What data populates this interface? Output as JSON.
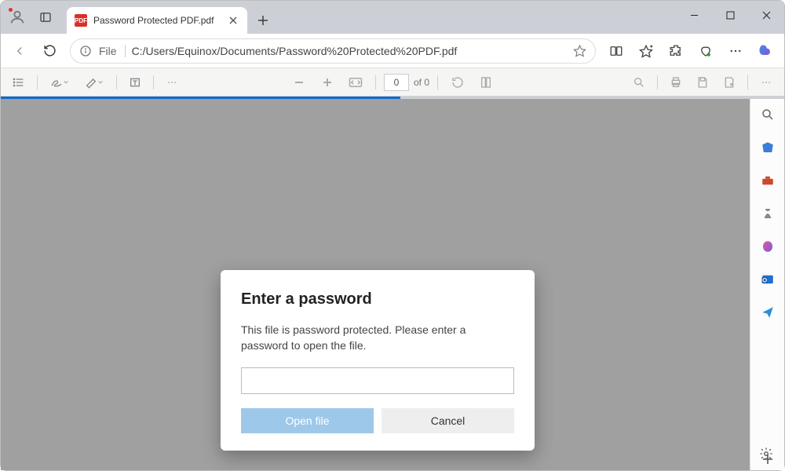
{
  "tab": {
    "title": "Password Protected PDF.pdf",
    "favicon_text": "PDF"
  },
  "address": {
    "scheme": "File",
    "path": "C:/Users/Equinox/Documents/Password%20Protected%20PDF.pdf"
  },
  "pdf": {
    "page_current": "0",
    "page_total": "of 0"
  },
  "dialog": {
    "title": "Enter a password",
    "message": "This file is password protected. Please enter a password to open the file.",
    "open_label": "Open file",
    "cancel_label": "Cancel"
  }
}
